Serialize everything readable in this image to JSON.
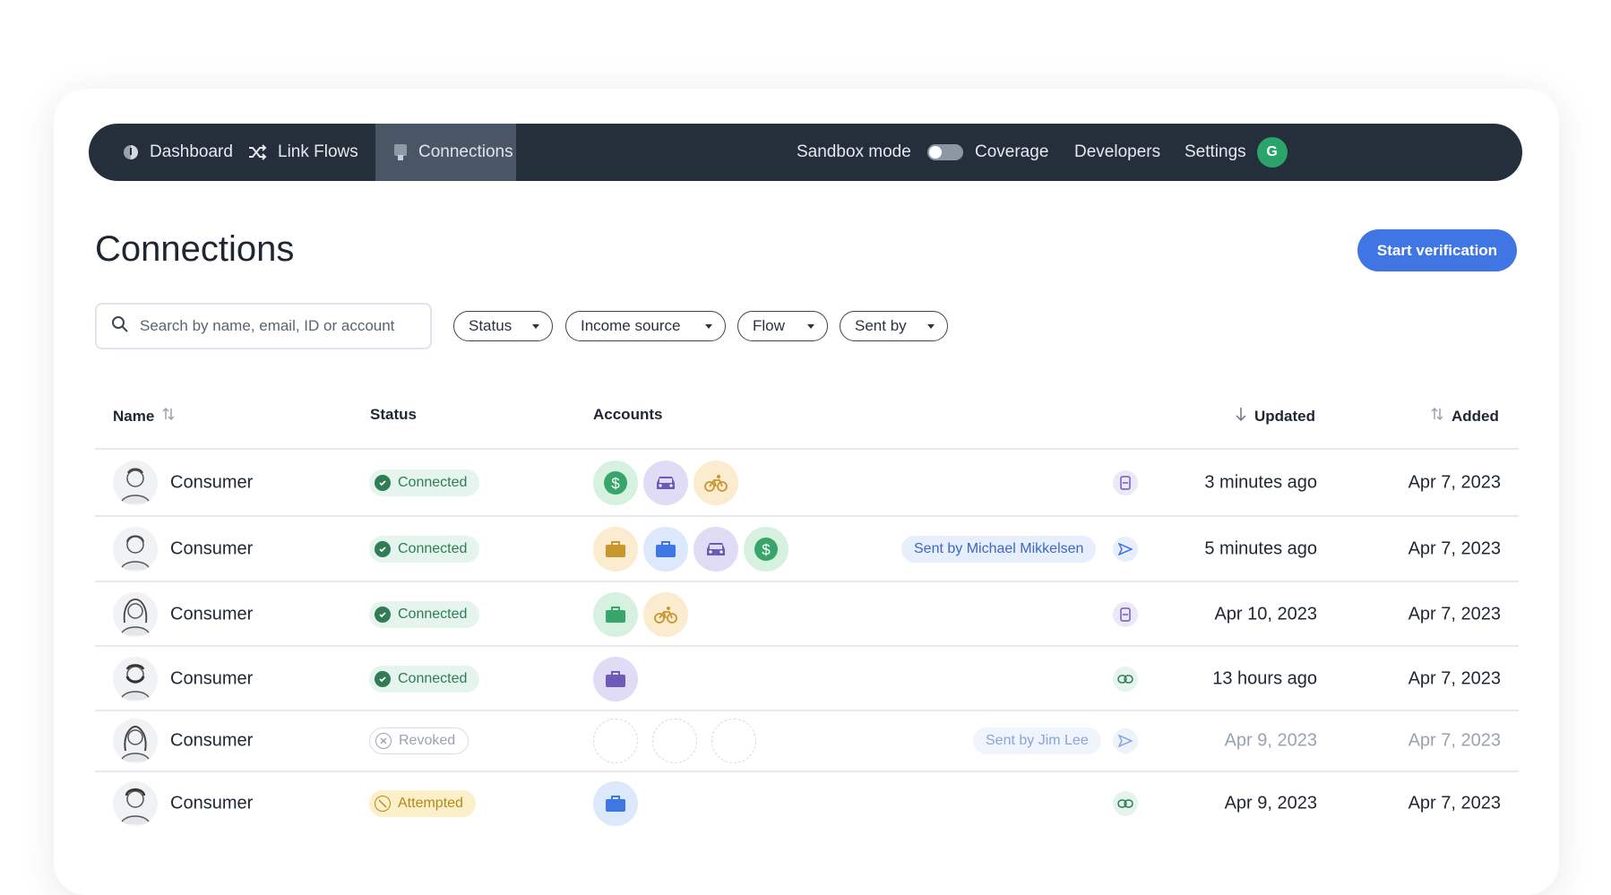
{
  "nav": {
    "dashboard": "Dashboard",
    "link_flows": "Link Flows",
    "connections": "Connections",
    "sandbox_mode": "Sandbox mode",
    "coverage": "Coverage",
    "developers": "Developers",
    "settings": "Settings",
    "avatar_initial": "G"
  },
  "page": {
    "title": "Connections",
    "start_button": "Start verification"
  },
  "search": {
    "placeholder": "Search by name, email, ID or account",
    "value": ""
  },
  "filters": [
    "Status",
    "Income source",
    "Flow",
    "Sent by"
  ],
  "columns": {
    "name": "Name",
    "status": "Status",
    "accounts": "Accounts",
    "updated": "Updated",
    "added": "Added"
  },
  "rows": [
    {
      "name": "Consumer",
      "status": "Connected",
      "accounts": [
        "dollar-icon",
        "car-icon",
        "bicycle-icon"
      ],
      "sent_by": "",
      "action_icon": "scan-icon",
      "updated": "3 minutes ago",
      "added": "Apr 7, 2023"
    },
    {
      "name": "Consumer",
      "status": "Connected",
      "accounts": [
        "briefcase-icon",
        "briefcase-icon",
        "car-icon",
        "dollar-icon"
      ],
      "sent_by": "Sent by Michael Mikkelsen",
      "action_icon": "send-icon",
      "updated": "5 minutes ago",
      "added": "Apr 7, 2023"
    },
    {
      "name": "Consumer",
      "status": "Connected",
      "accounts": [
        "briefcase-icon",
        "bicycle-icon"
      ],
      "sent_by": "",
      "action_icon": "scan-icon",
      "updated": "Apr 10, 2023",
      "added": "Apr 7, 2023"
    },
    {
      "name": "Consumer",
      "status": "Connected",
      "accounts": [
        "briefcase-icon"
      ],
      "sent_by": "",
      "action_icon": "link-icon",
      "updated": "13 hours ago",
      "added": "Apr 7, 2023"
    },
    {
      "name": "Consumer",
      "status": "Revoked",
      "accounts": [],
      "sent_by": "Sent by Jim Lee",
      "action_icon": "send-icon",
      "updated": "Apr 9, 2023",
      "added": "Apr 7, 2023"
    },
    {
      "name": "Consumer",
      "status": "Attempted",
      "accounts": [
        "briefcase-icon"
      ],
      "sent_by": "",
      "action_icon": "link-icon",
      "updated": "Apr 9, 2023",
      "added": "Apr 7, 2023"
    }
  ],
  "colors": {
    "nav_bg": "#252e3b",
    "accent_blue": "#3f76e4",
    "connected_green": "#2f7d55",
    "attempted_amber": "#b48a1a"
  }
}
